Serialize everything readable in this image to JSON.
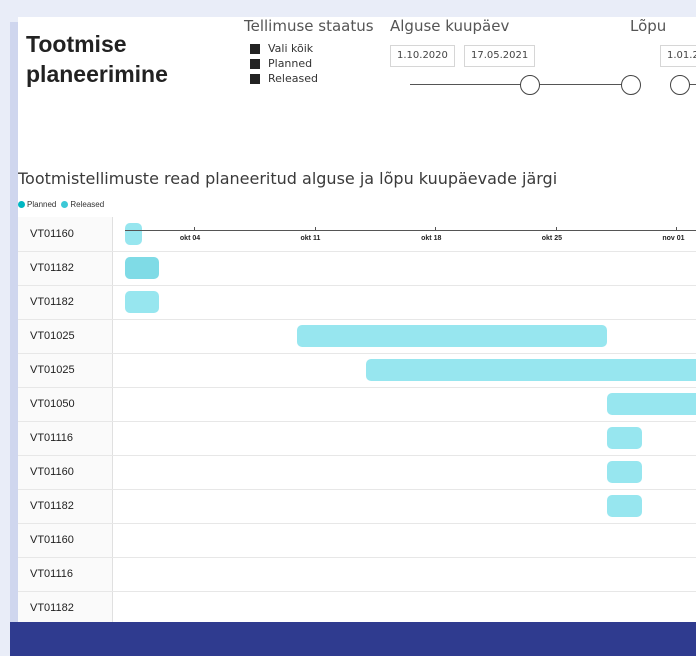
{
  "report": {
    "title_line1": "Tootmise",
    "title_line2": "planeerimine"
  },
  "slicers": {
    "status": {
      "title": "Tellimuse staatus",
      "options": [
        "Vali kõik",
        "Planned",
        "Released"
      ]
    },
    "start": {
      "title": "Alguse kuupäev",
      "from": "1.10.2020",
      "to": "17.05.2021"
    },
    "end": {
      "title": "Lõpu",
      "from": "1.01.2"
    }
  },
  "visual": {
    "title": "Tootmistellimuste read planeeritud alguse ja lõpu kuupäevade järgi",
    "legend": [
      {
        "label": "Planned",
        "color": "#00b7c3"
      },
      {
        "label": "Released",
        "color": "#3cc8d6"
      }
    ]
  },
  "chart_data": {
    "type": "gantt",
    "x_ticks": [
      "okt 04",
      "okt 11",
      "okt 18",
      "okt 25",
      "nov 01"
    ],
    "rows": [
      {
        "label": "VT01160",
        "start": "2020-09-30",
        "end": "2020-10-01",
        "color": "#97e6ef"
      },
      {
        "label": "VT01182",
        "start": "2020-09-30",
        "end": "2020-10-02",
        "color": "#7fdbe6"
      },
      {
        "label": "VT01182",
        "start": "2020-09-30",
        "end": "2020-10-02",
        "color": "#97e6ef"
      },
      {
        "label": "VT01025",
        "start": "2020-10-10",
        "end": "2020-10-28",
        "color": "#97e6ef"
      },
      {
        "label": "VT01025",
        "start": "2020-10-14",
        "end": "2020-11-05",
        "color": "#97e6ef"
      },
      {
        "label": "VT01050",
        "start": "2020-10-28",
        "end": "2020-11-05",
        "color": "#97e6ef"
      },
      {
        "label": "VT01116",
        "start": "2020-10-28",
        "end": "2020-10-30",
        "color": "#97e6ef"
      },
      {
        "label": "VT01160",
        "start": "2020-10-28",
        "end": "2020-10-30",
        "color": "#97e6ef"
      },
      {
        "label": "VT01182",
        "start": "2020-10-28",
        "end": "2020-10-30",
        "color": "#97e6ef"
      },
      {
        "label": "VT01160",
        "start": null,
        "end": null,
        "color": "#97e6ef"
      },
      {
        "label": "VT01116",
        "start": null,
        "end": null,
        "color": "#97e6ef"
      },
      {
        "label": "VT01182",
        "start": null,
        "end": null,
        "color": "#97e6ef"
      }
    ]
  }
}
